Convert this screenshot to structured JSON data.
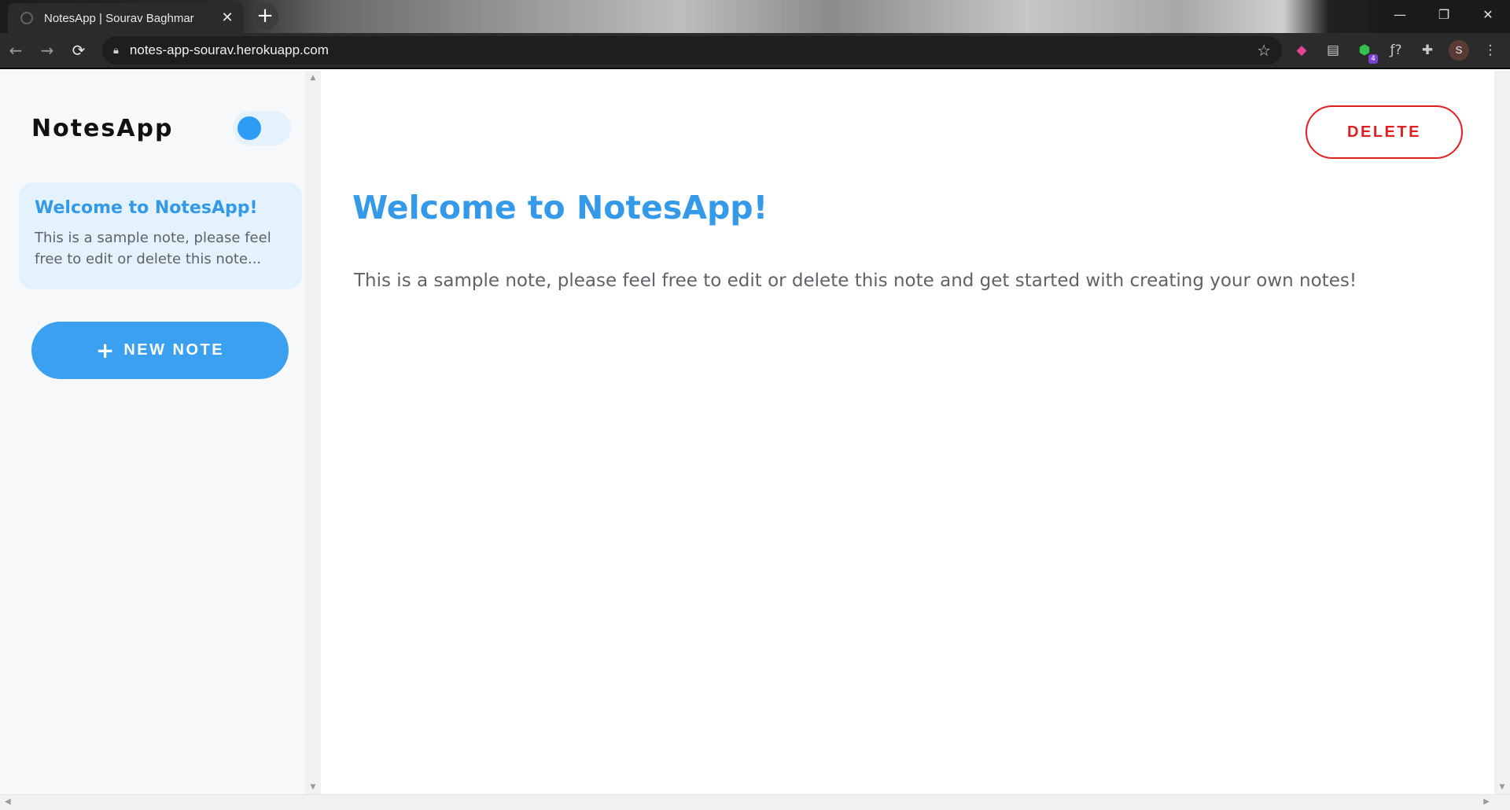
{
  "browser": {
    "tab_title": "NotesApp | Sourav Baghmar",
    "tab_close": "✕",
    "new_tab": "+",
    "url": "notes-app-sourav.herokuapp.com",
    "profile_initial": "S",
    "extension_badge": "4",
    "window_controls": {
      "minimize": "—",
      "restore": "❐",
      "close": "✕"
    },
    "nav": {
      "back": "←",
      "forward": "→",
      "reload": "⟳"
    },
    "icons": [
      "lock-icon",
      "star-icon",
      "color-picker-icon",
      "reader-icon",
      "green-extension-icon",
      "formula-icon",
      "puzzle-icon",
      "menu-icon"
    ]
  },
  "sidebar": {
    "brand": "NotesApp",
    "theme_toggle_on": true,
    "notes": [
      {
        "title": "Welcome to NotesApp!",
        "preview": "This is a sample note, please feel free to edit or delete this note..."
      }
    ],
    "new_note_label": "NEW NOTE",
    "new_note_icon": "+"
  },
  "main": {
    "delete_label": "DELETE",
    "note_title": "Welcome to NotesApp!",
    "note_body": "This is a sample note, please feel free to edit or delete this note and get started with creating your own notes!"
  },
  "colors": {
    "accent": "#3aa0ef",
    "title": "#3399e8",
    "delete": "#e02020",
    "card_bg": "#e3f2fd"
  }
}
